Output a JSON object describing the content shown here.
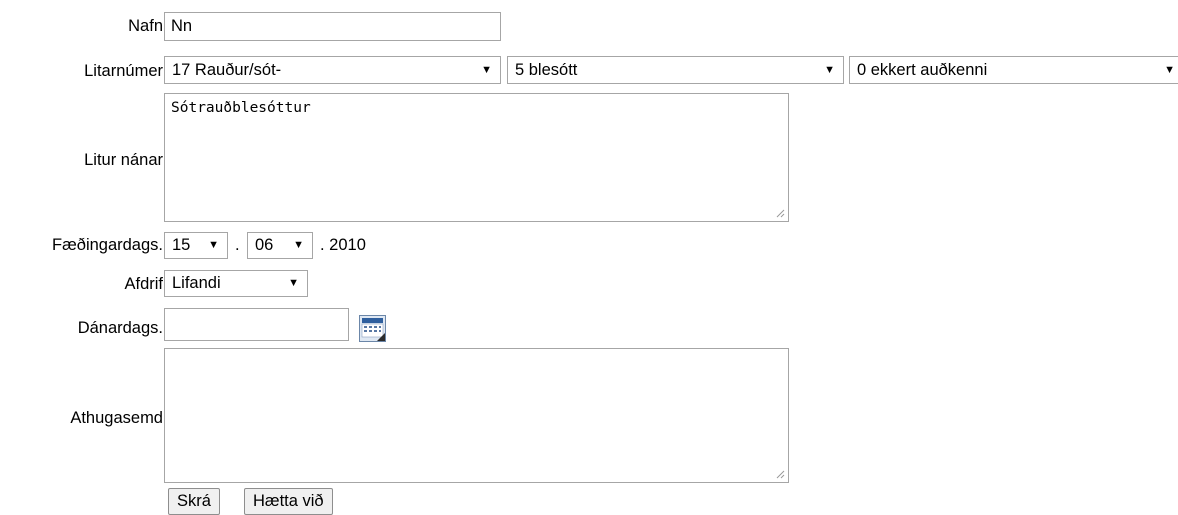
{
  "form": {
    "name": {
      "label": "Nafn",
      "value": "Nn"
    },
    "color_number": {
      "label": "Litarnúmer",
      "select1": "17 Rauður/sót-",
      "select2": "5 blesótt",
      "select3": "0 ekkert auðkenni"
    },
    "color_detail": {
      "label": "Litur nánar",
      "value": "Sótrauðblesóttur"
    },
    "birth_date": {
      "label": "Fæðingardags.",
      "day": "15",
      "month": "06",
      "sep": ".",
      "year": ". 2010"
    },
    "fate": {
      "label": "Afdrif",
      "value": "Lifandi"
    },
    "death_date": {
      "label": "Dánardags.",
      "value": ""
    },
    "comment": {
      "label": "Athugasemd",
      "value": ""
    },
    "buttons": {
      "submit": "Skrá",
      "cancel": "Hætta við"
    }
  },
  "icons": {
    "dropdown": "triangle-down",
    "calendar": "calendar-icon",
    "resize": "resize-grip-icon"
  }
}
